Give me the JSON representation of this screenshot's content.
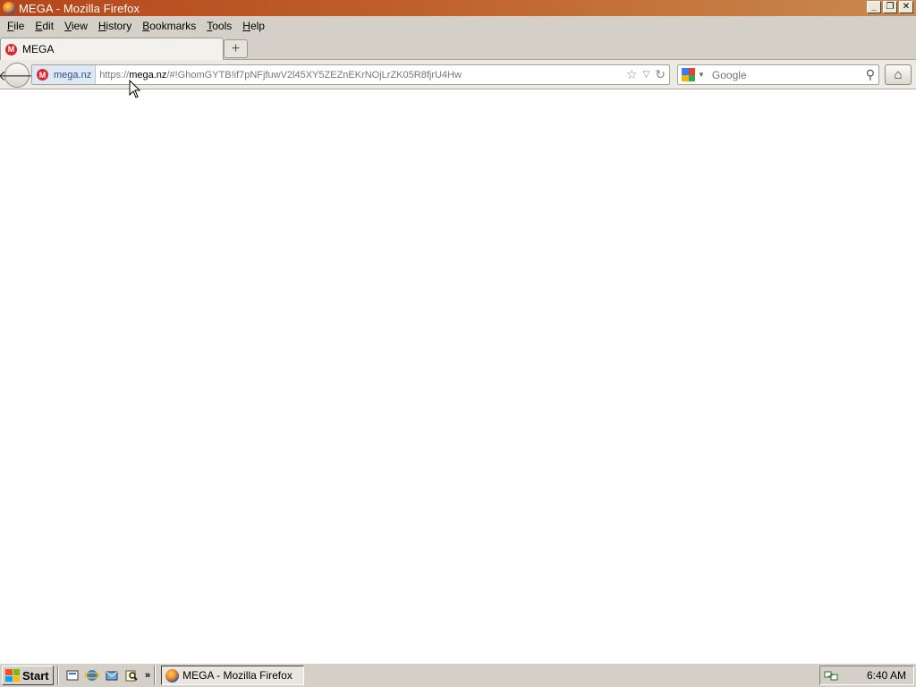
{
  "window": {
    "title": "MEGA - Mozilla Firefox",
    "controls": {
      "minimize": "_",
      "maximize": "❐",
      "close": "✕"
    }
  },
  "menubar": {
    "items": [
      {
        "accel": "F",
        "rest": "ile"
      },
      {
        "accel": "E",
        "rest": "dit"
      },
      {
        "accel": "V",
        "rest": "iew"
      },
      {
        "accel": "H",
        "rest": "istory"
      },
      {
        "accel": "B",
        "rest": "ookmarks"
      },
      {
        "accel": "T",
        "rest": "ools"
      },
      {
        "accel": "H",
        "rest": "elp"
      }
    ]
  },
  "tabs": {
    "active": {
      "label": "MEGA",
      "icon_letter": "M"
    },
    "new_tab": "+"
  },
  "navbar": {
    "back": "🡐",
    "identity_label": "mega.nz",
    "identity_icon": "M",
    "url_prefix": "https://",
    "url_host": "mega.nz",
    "url_rest": "/#!GhomGYTB!if7pNFjfuwV2l45XY5ZEZnEKrNOjLrZK05R8fjrU4Hw",
    "bookmark_star": "☆",
    "dropdown": "▽",
    "reload": "↻",
    "search_placeholder": "Google",
    "search_engine_drop": "▼",
    "search_go": "⚲",
    "home": "⌂"
  },
  "taskbar": {
    "start_label": "Start",
    "quicklaunch_more": "»",
    "task_label": "MEGA - Mozilla Firefox",
    "clock": "6:40 AM"
  },
  "colors": {
    "titlebar_start": "#b4471c",
    "titlebar_end": "#c98a4e",
    "chrome": "#d4d0c8",
    "mega_red": "#d9272e"
  }
}
